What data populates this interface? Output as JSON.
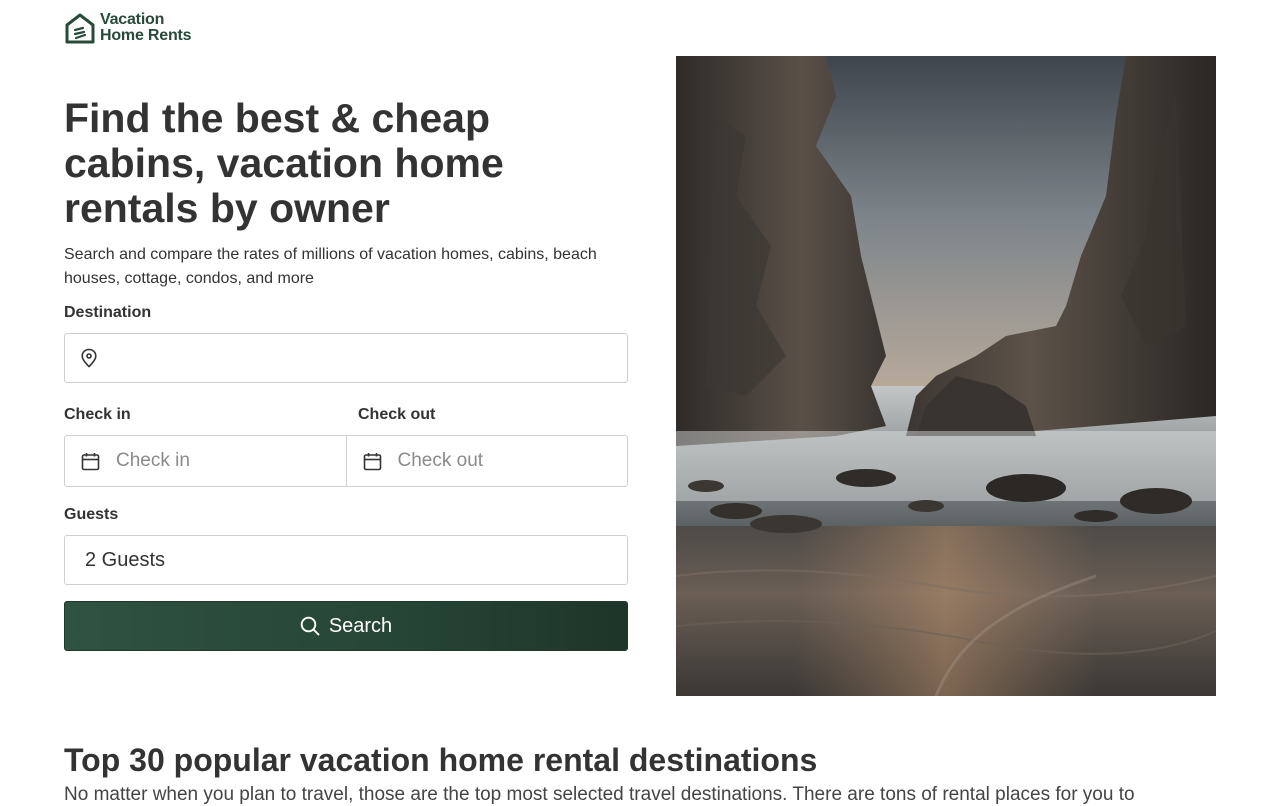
{
  "brand": {
    "line1": "Vacation",
    "line2": "Home Rents",
    "color": "#274a39",
    "icon": "house-logo-icon"
  },
  "hero": {
    "title": "Find the best & cheap cabins, vacation home rentals by owner",
    "subtitle": "Search and compare the rates of millions of vacation homes, cabins, beach houses, cottage, condos, and more"
  },
  "form": {
    "destination_label": "Destination",
    "destination_value": "",
    "destination_icon": "map-pin-icon",
    "checkin_label": "Check in",
    "checkin_placeholder": "Check in",
    "checkout_label": "Check out",
    "checkout_placeholder": "Check out",
    "calendar_icon": "calendar-icon",
    "guests_label": "Guests",
    "guests_value": "2 Guests",
    "search_label": "Search",
    "search_icon": "search-icon",
    "button_color": "#2a4a3a"
  },
  "popular": {
    "title": "Top 30 popular vacation home rental destinations",
    "text": "No matter when you plan to travel, those are the top most selected travel destinations. There are tons of rental places for you to"
  }
}
